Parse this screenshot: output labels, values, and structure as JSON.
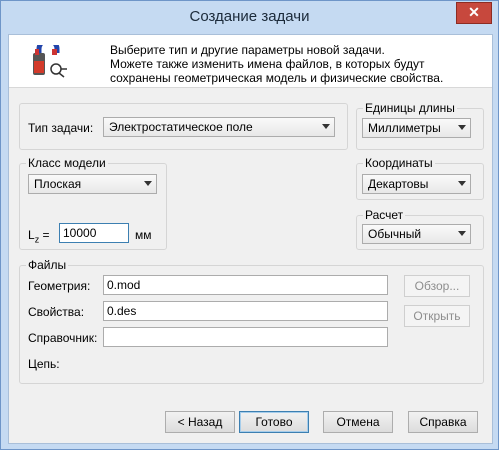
{
  "window": {
    "title": "Создание задачи",
    "close_symbol": "✕"
  },
  "header": {
    "lines": [
      "Выберите тип и другие параметры новой задачи.",
      "Можете также изменить имена файлов, в которых будут",
      "сохранены геометрическая модель и физические свойства."
    ]
  },
  "task_type": {
    "label": "Тип задачи:",
    "value": "Электростатическое поле"
  },
  "length_units": {
    "label": "Единицы длины",
    "value": "Миллиметры"
  },
  "model_class": {
    "label": "Класс модели",
    "value": "Плоская"
  },
  "lz": {
    "label": "L",
    "sub": "z",
    "eq": " =",
    "value": "10000",
    "unit": "мм"
  },
  "coordinates": {
    "label": "Координаты",
    "value": "Декартовы"
  },
  "calculation": {
    "label": "Расчет",
    "value": "Обычный"
  },
  "files": {
    "label": "Файлы",
    "geometry_label": "Геометрия:",
    "geometry_value": "0.mod",
    "properties_label": "Свойства:",
    "properties_value": "0.des",
    "reference_label": "Справочник:",
    "reference_value": "",
    "chain_label": "Цепь:",
    "browse_button": "Обзор...",
    "open_button": "Открыть"
  },
  "buttons": {
    "back": "< Назад",
    "ok": "Готово",
    "cancel": "Отмена",
    "help": "Справка"
  },
  "colors": {
    "title_bar": "#c5daf2",
    "close_button": "#c7483d",
    "focus_border": "#3c7fb1"
  }
}
